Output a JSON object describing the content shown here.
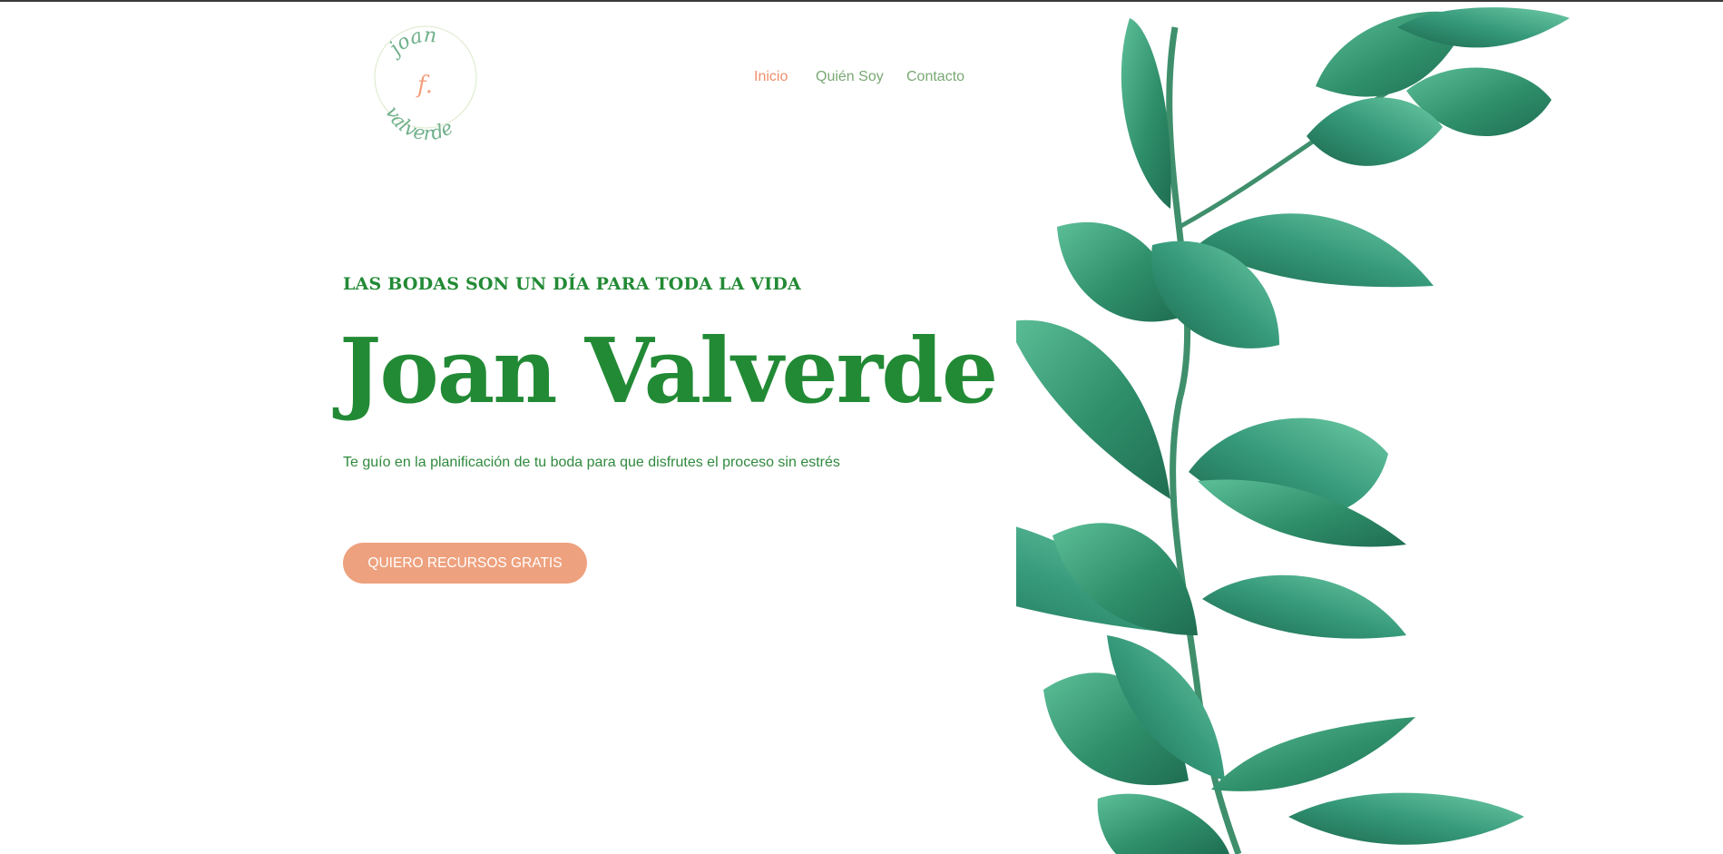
{
  "header": {
    "logo": {
      "text_top": "joan",
      "initial": "f.",
      "text_bottom": "valverde",
      "colors": {
        "script": "#6fb08a",
        "initial": "#f2a07e",
        "ring": "#d6e6c2"
      }
    },
    "nav": {
      "items": [
        {
          "label": "Inicio",
          "active": true
        },
        {
          "label": "Quién Soy",
          "active": false
        },
        {
          "label": "Contacto",
          "active": false
        }
      ]
    }
  },
  "hero": {
    "kicker": "LAS BODAS SON UN DÍA PARA TODA LA VIDA",
    "title": "Joan Valverde",
    "subtitle": "Te guío en la planificación de tu boda para que disfrutes el proceso sin estrés",
    "cta_label": "QUIERO RECURSOS GRATIS"
  },
  "decor": {
    "image": "eucalyptus-branch"
  },
  "colors": {
    "primary_green": "#228a35",
    "nav_green": "#7aa874",
    "accent_coral": "#ef8f6c",
    "button_bg": "#eea17e",
    "leaf_green": "#3a9a74"
  }
}
